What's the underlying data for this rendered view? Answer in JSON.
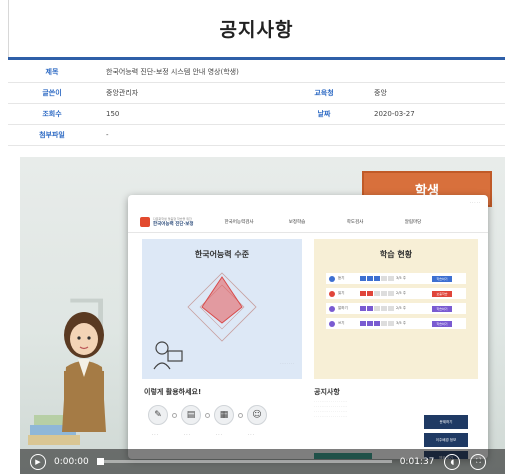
{
  "page": {
    "title": "공지사항"
  },
  "info": {
    "subject_label": "제목",
    "subject_value": "한국어능력 진단-보정 시스템 안내 영상(학생)",
    "author_label": "글쓴이",
    "author_value": "중앙관리자",
    "office_label": "교육청",
    "office_value": "중앙",
    "views_label": "조회수",
    "views_value": "150",
    "date_label": "날짜",
    "date_value": "2020-03-27",
    "attachment_label": "첨부파일",
    "attachment_value": "-"
  },
  "video": {
    "student_tag": "학생",
    "current_time": "0:00:00",
    "total_time": "0:01:37",
    "progress": 0.0,
    "embedded_site": {
      "logo_small": "다문화학생 맞춤형 학습을 위한",
      "logo_name": "한국어능력 진단·보정",
      "menus": [
        "한국어능력검사",
        "보정학습",
        "학도검사",
        "알림마당"
      ],
      "left_panel_title": "한국어능력 수준",
      "right_panel_title": "학습 현황",
      "status_rows": [
        {
          "label": "듣기",
          "value": "3/5 주",
          "color": "#3d6fd1",
          "pill": "학습하기",
          "pill_color": "#3d6fd1"
        },
        {
          "label": "읽기",
          "value": "2/5 주",
          "color": "#e0453a",
          "pill": "보충학습",
          "pill_color": "#e0453a"
        },
        {
          "label": "말하기",
          "value": "2/5 주",
          "color": "#7a5bd1",
          "pill": "학습하기",
          "pill_color": "#7a5bd1"
        },
        {
          "label": "쓰기",
          "value": "3/5 주",
          "color": "#7a5bd1",
          "pill": "학습하기",
          "pill_color": "#7a5bd1"
        }
      ],
      "howto_title": "이렇게 활용하세요!",
      "notice_title": "공지사항",
      "side_buttons": [
        "문제하기",
        "이주배경 정보",
        "웹을 보기"
      ]
    }
  },
  "colors": {
    "accent": "#2f6bc4",
    "title_border": "#2f5fa8",
    "student_tag": "#d8703c"
  },
  "icons": {
    "play": "play-icon",
    "volume": "volume-icon",
    "fullscreen": "fullscreen-icon"
  }
}
